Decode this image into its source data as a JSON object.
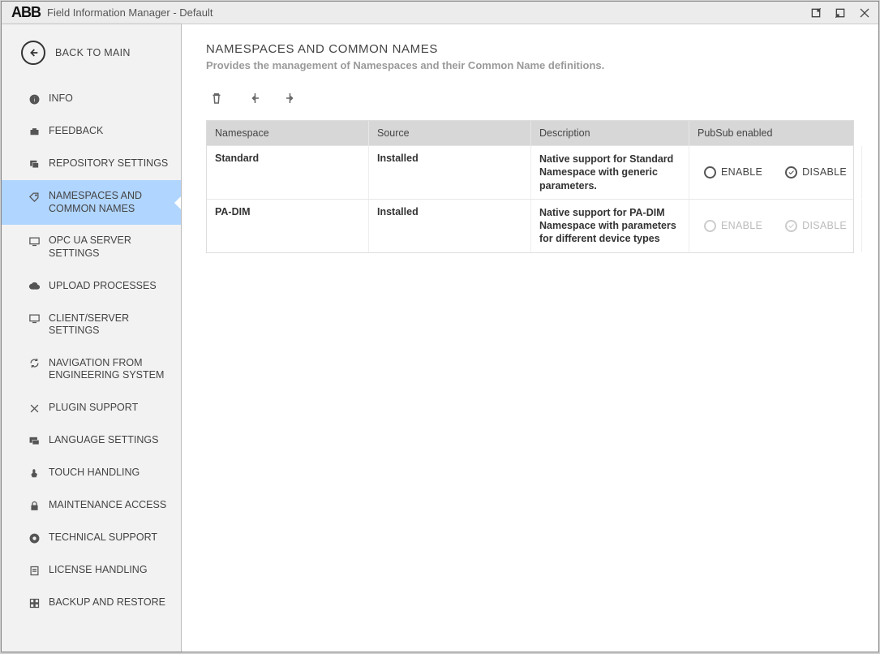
{
  "titlebar": {
    "logo_text": "ABB",
    "app_title": "Field Information Manager - Default"
  },
  "sidebar": {
    "back_label": "BACK TO MAIN",
    "items": [
      {
        "label": "INFO",
        "icon": "info"
      },
      {
        "label": "FEEDBACK",
        "icon": "feedback"
      },
      {
        "label": "REPOSITORY SETTINGS",
        "icon": "repo"
      },
      {
        "label": "NAMESPACES AND COMMON NAMES",
        "icon": "tag",
        "selected": true
      },
      {
        "label": "OPC UA SERVER SETTINGS",
        "icon": "monitor"
      },
      {
        "label": "UPLOAD PROCESSES",
        "icon": "cloud"
      },
      {
        "label": "CLIENT/SERVER SETTINGS",
        "icon": "monitor"
      },
      {
        "label": "NAVIGATION FROM ENGINEERING SYSTEM",
        "icon": "refresh"
      },
      {
        "label": "PLUGIN SUPPORT",
        "icon": "tools"
      },
      {
        "label": "LANGUAGE SETTINGS",
        "icon": "chat"
      },
      {
        "label": "TOUCH HANDLING",
        "icon": "touch"
      },
      {
        "label": "MAINTENANCE ACCESS",
        "icon": "lock"
      },
      {
        "label": "TECHNICAL SUPPORT",
        "icon": "support"
      },
      {
        "label": "LICENSE HANDLING",
        "icon": "license"
      },
      {
        "label": "BACKUP AND RESTORE",
        "icon": "backup"
      }
    ]
  },
  "page": {
    "title": "NAMESPACES AND COMMON NAMES",
    "subtitle": "Provides the management of Namespaces and their Common Name definitions."
  },
  "table": {
    "headers": {
      "namespace": "Namespace",
      "source": "Source",
      "description": "Description",
      "pubsub": "PubSub enabled"
    },
    "pubsub_options": {
      "enable": "ENABLE",
      "disable": "DISABLE"
    },
    "rows": [
      {
        "namespace": "Standard",
        "source": "Installed",
        "description": "Native support for Standard Namespace with generic parameters.",
        "pubsub_value": "disable",
        "pubsub_editable": true
      },
      {
        "namespace": "PA-DIM",
        "source": "Installed",
        "description": "Native support for PA-DIM Namespace with parameters for different device types",
        "pubsub_value": "disable",
        "pubsub_editable": false
      }
    ]
  }
}
